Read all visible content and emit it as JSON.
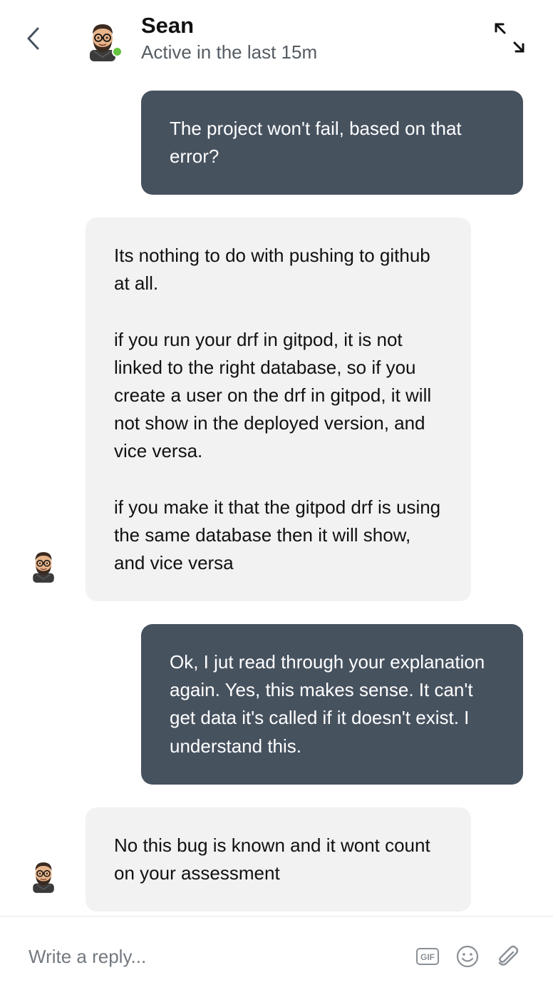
{
  "header": {
    "contact_name": "Sean",
    "status": "Active in the last 15m",
    "online_color": "#64c340",
    "icons": {
      "back": "chevron-left-icon",
      "expand": "expand-arrows-icon"
    }
  },
  "messages": [
    {
      "direction": "outgoing",
      "text": "The project won't fail, based on that error?"
    },
    {
      "direction": "incoming",
      "text": "Its nothing to do with pushing to github at all.\n\nif you run your drf in gitpod, it is not linked to the right database, so if you create a user on the drf in gitpod, it will not show in the deployed version, and vice versa.\n\nif you make it that the gitpod drf is using the same database then it will show, and vice versa"
    },
    {
      "direction": "outgoing",
      "text": "Ok, I jut read through your explanation again. Yes, this makes sense. It can't get data it's called if it doesn't exist. I understand this."
    },
    {
      "direction": "incoming",
      "text": "No this bug is known and it wont count on your assessment"
    }
  ],
  "composer": {
    "placeholder": "Write a reply...",
    "value": "",
    "gif_label": "GIF",
    "icons": [
      "gif-icon",
      "emoji-icon",
      "attachment-icon"
    ]
  },
  "colors": {
    "outgoing_bubble": "#47525f",
    "incoming_bubble": "#f2f2f2"
  }
}
